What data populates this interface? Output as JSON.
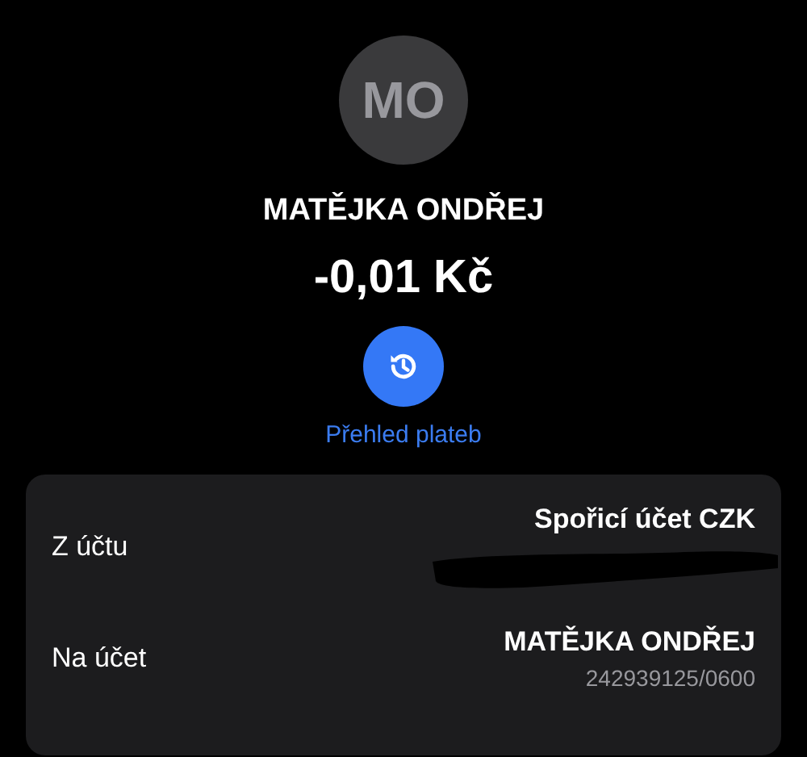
{
  "avatar": {
    "initials": "MO"
  },
  "name": "MATĚJKA ONDŘEJ",
  "amount": "-0,01 Kč",
  "history_link": "Přehled plateb",
  "details": [
    {
      "label": "Z účtu",
      "value": "Spořicí účet CZK",
      "redacted": true
    },
    {
      "label": "Na účet",
      "value": "MATĚJKA ONDŘEJ",
      "detail": "242939125/0600",
      "redacted": false
    }
  ]
}
